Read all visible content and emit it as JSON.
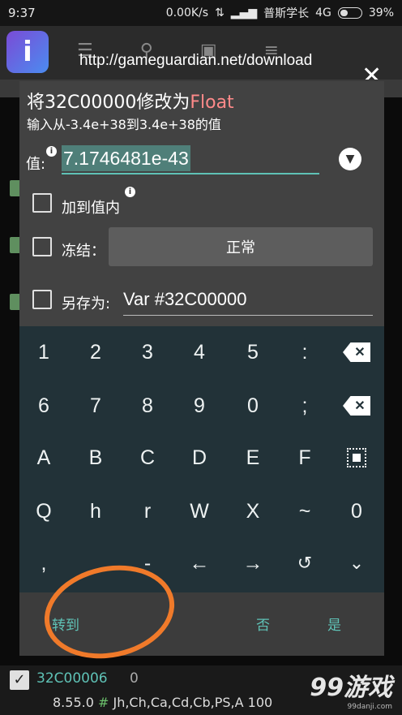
{
  "status": {
    "time": "9:37",
    "net_speed": "0.00K/s",
    "carrier": "普斯学长",
    "network": "4G",
    "battery_pct": "39%",
    "battery_level": 0.39
  },
  "app": {
    "url": "http://gameguardian.net/download",
    "close": "✕"
  },
  "dialog": {
    "title_prefix": "将32C00000修改为",
    "title_type": "Float",
    "subtitle": "输入从-3.4e+38到3.4e+38的值",
    "value_label": "值:",
    "value": "7.1746481e-43",
    "add_to_value_label": "加到值内",
    "freeze_label": "冻结：",
    "freeze_mode": "正常",
    "save_as_label": "另存为:",
    "save_as_value": "Var #32C00000"
  },
  "keyboard": {
    "row1": [
      "1",
      "2",
      "3",
      "4",
      "5",
      ":"
    ],
    "row2": [
      "6",
      "7",
      "8",
      "9",
      "0",
      ";"
    ],
    "row3": [
      "A",
      "B",
      "C",
      "D",
      "E",
      "F"
    ],
    "row4": [
      "Q",
      "h",
      "r",
      "W",
      "X",
      "~",
      "0"
    ],
    "row5": [
      ",",
      "",
      "-",
      "←",
      "→"
    ]
  },
  "actions": {
    "goto": "转到",
    "no": "否",
    "yes": "是"
  },
  "bottom": {
    "address": "32C00006",
    "value": "0",
    "version": "8.55.0",
    "hash": "#",
    "filters": "Jh,Ch,Ca,Cd,Cb,PS,A",
    "count": "100"
  },
  "watermark": {
    "brand": "99游戏",
    "domain": "99danji.com"
  }
}
